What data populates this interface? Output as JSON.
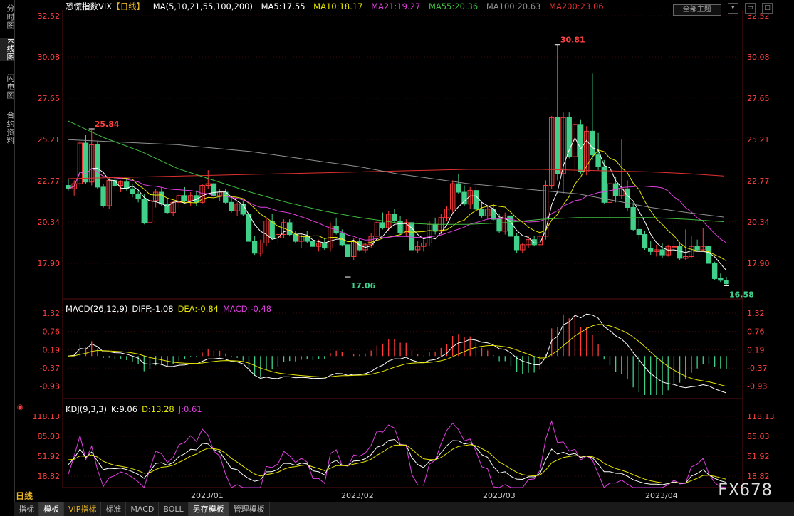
{
  "left_tabs": [
    "分时图",
    "K线图",
    "闪电图",
    "合约资料"
  ],
  "active_left_tab": 1,
  "header": {
    "title": "恐慌指数VIX",
    "period_tag": "【日线】",
    "ma_params": "MA(5,10,21,55,100,200)",
    "ma5": "MA5:17.55",
    "ma10": "MA10:18.17",
    "ma21": "MA21:19.27",
    "ma55": "MA55:20.36",
    "ma100": "MA100:20.63",
    "ma200": "MA200:23.06"
  },
  "theme_button": "全部主题",
  "colors": {
    "up": "#ff3b3b",
    "down": "#40d08a",
    "ma5": "#ffffff",
    "ma10": "#e6e600",
    "ma21": "#e040e0",
    "ma55": "#40c040",
    "ma100": "#909090",
    "ma200": "#e03030",
    "axis_text": "#ff4040",
    "grid": "#3a0a0a"
  },
  "price_axis": [
    "32.52",
    "30.08",
    "27.65",
    "25.21",
    "22.77",
    "20.34",
    "17.90"
  ],
  "annotations": {
    "high1": "25.84",
    "high2": "30.81",
    "low1": "17.06",
    "low2": "16.58"
  },
  "macd": {
    "label": "MACD(26,12,9)",
    "diff": "DIFF:-1.08",
    "dea": "DEA:-0.84",
    "macd": "MACD:-0.48",
    "axis": [
      "1.32",
      "0.76",
      "0.19",
      "-0.37",
      "-0.93"
    ]
  },
  "kdj": {
    "label": "KDJ(9,3,3)",
    "k": "K:9.06",
    "d": "D:13.28",
    "j": "J:0.61",
    "axis": [
      "118.13",
      "85.03",
      "51.92",
      "18.82"
    ]
  },
  "x_labels": [
    "2023/01",
    "2023/02",
    "2023/03",
    "2023/04"
  ],
  "period_label": "日线",
  "bottom_tabs": [
    "指标",
    "模板",
    "VIP指标",
    "标准",
    "MACD",
    "BOLL",
    "另存模板",
    "管理模板"
  ],
  "watermark": "FX678",
  "chart_data": {
    "type": "candlestick",
    "title": "恐慌指数VIX",
    "categories_note": "daily, Dec 2022 – Apr 2023",
    "ylim": [
      16.0,
      33.0
    ],
    "candles": [
      [
        22.5,
        22.9,
        22.2,
        22.3
      ],
      [
        22.3,
        22.8,
        21.9,
        22.6
      ],
      [
        22.6,
        25.2,
        22.4,
        25.0
      ],
      [
        25.0,
        25.5,
        22.6,
        22.7
      ],
      [
        22.7,
        25.8,
        22.5,
        24.9
      ],
      [
        24.9,
        25.1,
        22.3,
        22.4
      ],
      [
        22.4,
        22.6,
        21.2,
        21.3
      ],
      [
        21.3,
        23.0,
        21.1,
        22.8
      ],
      [
        22.8,
        23.1,
        22.3,
        22.5
      ],
      [
        22.5,
        22.8,
        22.1,
        22.7
      ],
      [
        22.7,
        22.9,
        22.2,
        22.3
      ],
      [
        22.3,
        22.6,
        21.8,
        22.0
      ],
      [
        22.0,
        22.2,
        21.5,
        21.7
      ],
      [
        21.7,
        22.0,
        20.2,
        20.3
      ],
      [
        20.3,
        21.8,
        20.1,
        21.6
      ],
      [
        21.6,
        22.3,
        21.2,
        22.1
      ],
      [
        22.1,
        22.4,
        21.3,
        21.4
      ],
      [
        21.4,
        21.7,
        20.8,
        20.9
      ],
      [
        20.9,
        21.6,
        20.7,
        21.5
      ],
      [
        21.5,
        22.0,
        21.1,
        21.9
      ],
      [
        21.9,
        22.4,
        21.5,
        21.6
      ],
      [
        21.6,
        22.1,
        21.3,
        21.9
      ],
      [
        21.9,
        22.2,
        21.3,
        21.5
      ],
      [
        21.5,
        22.6,
        21.4,
        22.5
      ],
      [
        22.5,
        23.4,
        22.3,
        22.6
      ],
      [
        22.6,
        23.0,
        21.8,
        21.9
      ],
      [
        21.9,
        22.3,
        21.6,
        22.1
      ],
      [
        22.1,
        22.3,
        21.4,
        21.5
      ],
      [
        21.5,
        21.8,
        20.9,
        21.0
      ],
      [
        21.0,
        21.5,
        20.7,
        21.4
      ],
      [
        21.4,
        21.6,
        20.7,
        20.8
      ],
      [
        20.8,
        21.2,
        19.1,
        19.2
      ],
      [
        19.2,
        19.5,
        18.4,
        18.5
      ],
      [
        18.5,
        19.3,
        18.3,
        19.1
      ],
      [
        19.1,
        20.6,
        18.9,
        20.4
      ],
      [
        20.4,
        20.8,
        19.3,
        19.4
      ],
      [
        19.4,
        19.7,
        19.1,
        19.6
      ],
      [
        19.6,
        20.5,
        19.4,
        20.3
      ],
      [
        20.3,
        20.5,
        19.5,
        19.6
      ],
      [
        19.6,
        19.8,
        19.1,
        19.2
      ],
      [
        19.2,
        19.6,
        18.8,
        19.5
      ],
      [
        19.5,
        19.8,
        19.1,
        19.2
      ],
      [
        19.2,
        19.4,
        18.8,
        18.9
      ],
      [
        18.9,
        19.3,
        18.6,
        19.1
      ],
      [
        19.1,
        19.4,
        18.7,
        18.8
      ],
      [
        18.8,
        20.3,
        18.6,
        20.1
      ],
      [
        20.1,
        20.6,
        19.6,
        19.7
      ],
      [
        19.7,
        19.9,
        18.9,
        19.0
      ],
      [
        19.0,
        19.2,
        17.1,
        18.3
      ],
      [
        18.3,
        19.4,
        18.1,
        19.2
      ],
      [
        19.2,
        19.4,
        18.6,
        18.7
      ],
      [
        18.7,
        19.1,
        18.5,
        19.0
      ],
      [
        19.0,
        19.7,
        18.8,
        19.5
      ],
      [
        19.5,
        20.4,
        19.3,
        20.3
      ],
      [
        20.3,
        20.9,
        19.9,
        20.0
      ],
      [
        20.0,
        21.0,
        19.8,
        20.8
      ],
      [
        20.8,
        21.1,
        20.3,
        20.4
      ],
      [
        20.4,
        20.7,
        19.6,
        19.7
      ],
      [
        19.7,
        20.5,
        19.5,
        20.3
      ],
      [
        20.3,
        20.5,
        18.6,
        18.7
      ],
      [
        18.7,
        19.2,
        18.5,
        18.9
      ],
      [
        18.9,
        19.3,
        18.6,
        19.1
      ],
      [
        19.1,
        20.4,
        18.9,
        20.2
      ],
      [
        20.2,
        20.6,
        19.6,
        19.8
      ],
      [
        19.8,
        20.8,
        19.6,
        20.6
      ],
      [
        20.6,
        21.3,
        20.4,
        21.1
      ],
      [
        21.1,
        22.8,
        20.9,
        22.6
      ],
      [
        22.6,
        23.2,
        22.0,
        22.1
      ],
      [
        22.1,
        22.5,
        21.3,
        21.4
      ],
      [
        21.4,
        22.4,
        21.1,
        22.2
      ],
      [
        22.2,
        22.5,
        21.0,
        21.1
      ],
      [
        21.1,
        21.5,
        20.6,
        20.7
      ],
      [
        20.7,
        21.3,
        20.5,
        21.1
      ],
      [
        21.1,
        21.4,
        20.4,
        20.5
      ],
      [
        20.5,
        20.8,
        19.7,
        19.8
      ],
      [
        19.8,
        20.9,
        19.6,
        20.7
      ],
      [
        20.7,
        21.2,
        19.4,
        19.5
      ],
      [
        19.5,
        19.7,
        18.5,
        18.7
      ],
      [
        18.7,
        19.1,
        18.5,
        19.0
      ],
      [
        19.0,
        19.5,
        18.8,
        19.3
      ],
      [
        19.3,
        19.5,
        18.9,
        19.0
      ],
      [
        19.0,
        19.8,
        18.9,
        19.5
      ],
      [
        19.5,
        22.8,
        19.3,
        22.5
      ],
      [
        22.5,
        26.6,
        22.3,
        26.5
      ],
      [
        26.5,
        30.81,
        22.8,
        23.2
      ],
      [
        23.2,
        26.8,
        22.0,
        26.5
      ],
      [
        26.5,
        26.8,
        24.1,
        24.2
      ],
      [
        24.2,
        26.2,
        23.0,
        26.1
      ],
      [
        26.1,
        26.4,
        23.2,
        23.3
      ],
      [
        23.3,
        26.0,
        23.1,
        25.7
      ],
      [
        25.7,
        29.1,
        24.0,
        24.3
      ],
      [
        24.3,
        25.6,
        23.4,
        23.6
      ],
      [
        23.6,
        24.0,
        21.4,
        21.5
      ],
      [
        21.5,
        23.5,
        20.3,
        22.6
      ],
      [
        22.6,
        23.0,
        21.5,
        21.9
      ],
      [
        21.9,
        25.2,
        21.7,
        22.3
      ],
      [
        22.3,
        22.8,
        21.0,
        21.2
      ],
      [
        21.2,
        21.5,
        19.8,
        19.9
      ],
      [
        19.9,
        20.6,
        19.3,
        19.6
      ],
      [
        19.6,
        19.8,
        18.7,
        18.8
      ],
      [
        18.8,
        19.2,
        18.4,
        18.6
      ],
      [
        18.6,
        19.0,
        18.3,
        18.7
      ],
      [
        18.7,
        19.1,
        18.2,
        18.4
      ],
      [
        18.4,
        19.0,
        18.3,
        18.9
      ],
      [
        18.9,
        20.0,
        18.7,
        18.9
      ],
      [
        18.9,
        19.1,
        18.1,
        18.2
      ],
      [
        18.2,
        19.9,
        18.1,
        18.3
      ],
      [
        18.3,
        19.5,
        18.2,
        18.9
      ],
      [
        18.9,
        19.3,
        18.6,
        18.7
      ],
      [
        18.7,
        20.0,
        18.6,
        18.9
      ],
      [
        18.9,
        19.1,
        17.8,
        17.9
      ],
      [
        17.9,
        18.0,
        16.9,
        17.0
      ],
      [
        17.0,
        17.3,
        16.8,
        16.9
      ],
      [
        16.9,
        17.1,
        16.58,
        16.7
      ]
    ],
    "series": [
      {
        "name": "MA200",
        "values": [
          22.9,
          22.95,
          23.0,
          23.05,
          23.1,
          23.15,
          23.2,
          23.25,
          23.3,
          23.35,
          23.4,
          23.45,
          23.45,
          23.45,
          23.4,
          23.35,
          23.3,
          23.2,
          23.06
        ]
      },
      {
        "name": "MA100",
        "values": [
          25.2,
          25.1,
          25.0,
          24.9,
          24.7,
          24.5,
          24.2,
          23.9,
          23.6,
          23.2,
          22.9,
          22.6,
          22.4,
          22.2,
          22.0,
          21.6,
          21.2,
          20.9,
          20.63
        ]
      },
      {
        "name": "MA55",
        "values": [
          26.3,
          25.3,
          24.5,
          23.5,
          22.8,
          22.1,
          21.5,
          21.0,
          20.6,
          20.3,
          20.2,
          20.2,
          20.3,
          20.5,
          20.6,
          20.6,
          20.6,
          20.5,
          20.36
        ]
      }
    ]
  }
}
